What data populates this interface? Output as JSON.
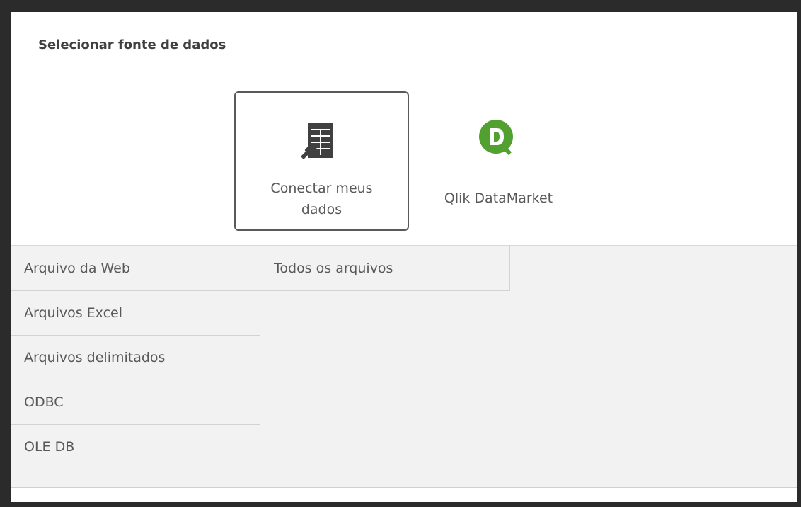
{
  "dialog": {
    "title": "Selecionar fonte de dados"
  },
  "sources": [
    {
      "label": "Conectar meus dados",
      "icon": "connector-table-icon",
      "selected": true
    },
    {
      "label": "Qlik DataMarket",
      "icon": "qlik-datamarket-logo-icon",
      "selected": false,
      "color": "#52a030"
    }
  ],
  "categories": [
    {
      "label": "Arquivo da Web"
    },
    {
      "label": "Arquivos Excel"
    },
    {
      "label": "Arquivos delimitados"
    },
    {
      "label": "ODBC"
    },
    {
      "label": "OLE DB"
    }
  ],
  "subcategories": [
    {
      "label": "Todos os arquivos"
    }
  ]
}
